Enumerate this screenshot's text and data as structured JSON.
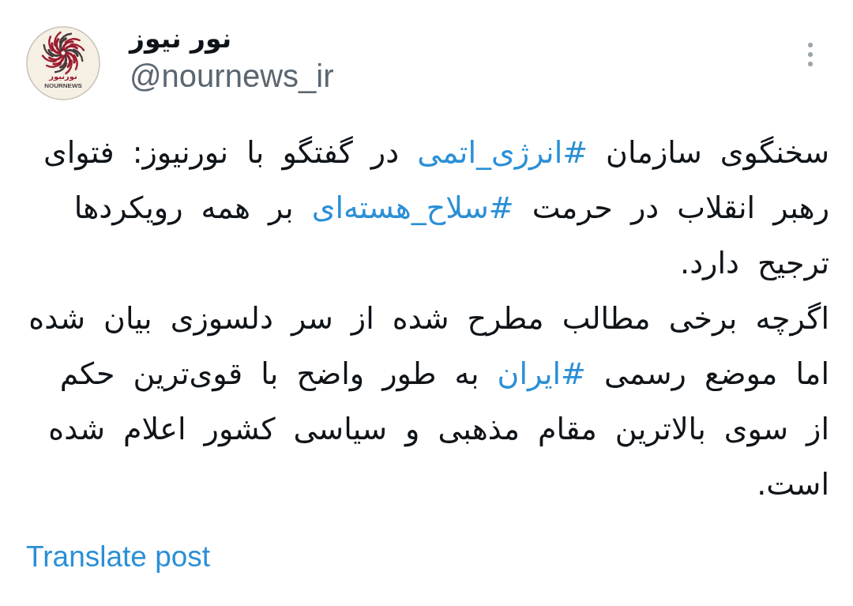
{
  "author": {
    "avatar": {
      "logo_lines": [
        "نورنیوز",
        "NOURNEWS"
      ]
    },
    "name": "نور نیوز",
    "handle": "@nournews_ir"
  },
  "post": {
    "paragraphs": [
      [
        {
          "kind": "text",
          "text": "سخنگوی سازمان "
        },
        {
          "kind": "hashtag",
          "text": "#انرژی_اتمی"
        },
        {
          "kind": "text",
          "text": " در گفتگو با نورنیوز: فتوای رهبر انقلاب در حرمت "
        },
        {
          "kind": "hashtag",
          "text": "#سلاح_هسته‌ای"
        },
        {
          "kind": "text",
          "text": " بر همه رویکردها ترجیح دارد."
        }
      ],
      [
        {
          "kind": "text",
          "text": "اگرچه برخی مطالب مطرح شده از سر دلسوزی بیان شده اما موضع رسمی "
        },
        {
          "kind": "hashtag",
          "text": "#ایران"
        },
        {
          "kind": "text",
          "text": " به طور واضح با قوی‌ترین حکم از سوی بالاترین مقام مذهبی و سیاسی کشور اعلام شده است."
        }
      ]
    ]
  },
  "translate_link": "Translate post"
}
